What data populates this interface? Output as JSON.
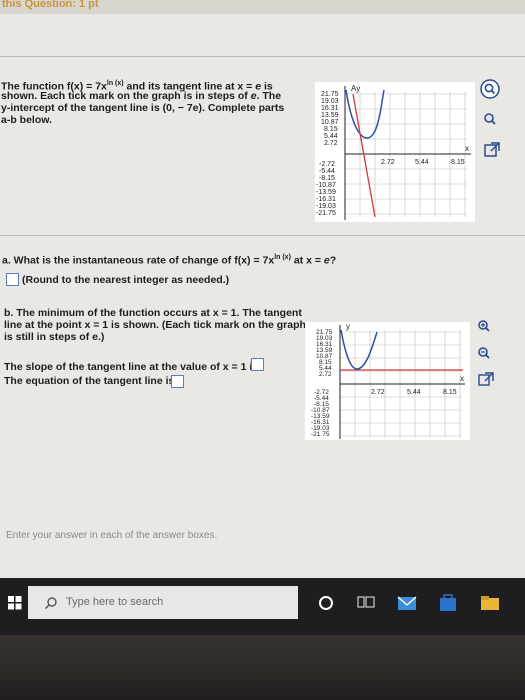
{
  "header": {
    "title": "this Question: 1 pt"
  },
  "intro": {
    "line1a": "The function f(x) = 7x",
    "line1sup": "ln (x)",
    "line1b": " and its tangent line at x = ",
    "line1e": "e",
    "line1c": " is",
    "line2a": "shown. Each tick mark on the graph is in steps of ",
    "line2e": "e",
    "line2b": ". The",
    "line3": "y-intercept of the tangent line is (0, − 7e). Complete parts",
    "line4": "a-b below."
  },
  "graph1": {
    "y_label": "Ay",
    "x_label": "x",
    "y_ticks_pos": [
      "21.75",
      "19.03",
      "16.31",
      "13.59",
      "10.87",
      "8.15",
      "5.44",
      "2.72"
    ],
    "y_ticks_neg": [
      "-2.72",
      "-5.44",
      "-8.15",
      "-10.87",
      "-13.59",
      "-16.31",
      "-19.03",
      "-21.75"
    ],
    "x_ticks": [
      "2.72",
      "5.44",
      "8.15"
    ]
  },
  "part_a": {
    "q1": "a. What is the instantaneous rate of change of f(x) = 7x",
    "sup": "ln (x)",
    "q2": " at x = ",
    "e": "e",
    "q3": "?",
    "hint": "(Round to the nearest integer as needed.)"
  },
  "part_b": {
    "l1": "b. The minimum of the function occurs at x = 1. The tangent",
    "l2": "line at the point x = 1 is shown. (Each tick mark on the graph",
    "l3": "is still in steps of e.)",
    "slope": "The slope of the tangent line at the value of x = 1 is",
    "equation": "The equation of the tangent line is"
  },
  "graph2": {
    "y_label": "y",
    "x_label": "x",
    "y_ticks_pos": [
      "21.75",
      "19.03",
      "16.31",
      "13.59",
      "10.87",
      "8.15",
      "5.44",
      "2.72"
    ],
    "y_ticks_neg": [
      "-2.72",
      "-5.44",
      "-8.15",
      "-10.87",
      "-13.59",
      "-16.31",
      "-19.03",
      "-21.75"
    ],
    "x_ticks": [
      "2.72",
      "5.44",
      "8.15"
    ]
  },
  "footer_note": "Enter your answer in each of the answer boxes.",
  "taskbar": {
    "search_placeholder": "Type here to search"
  },
  "colors": {
    "curve": "#2e4fa3",
    "tangent": "#d43a3a",
    "icon_blue": "#2a4b8f"
  }
}
